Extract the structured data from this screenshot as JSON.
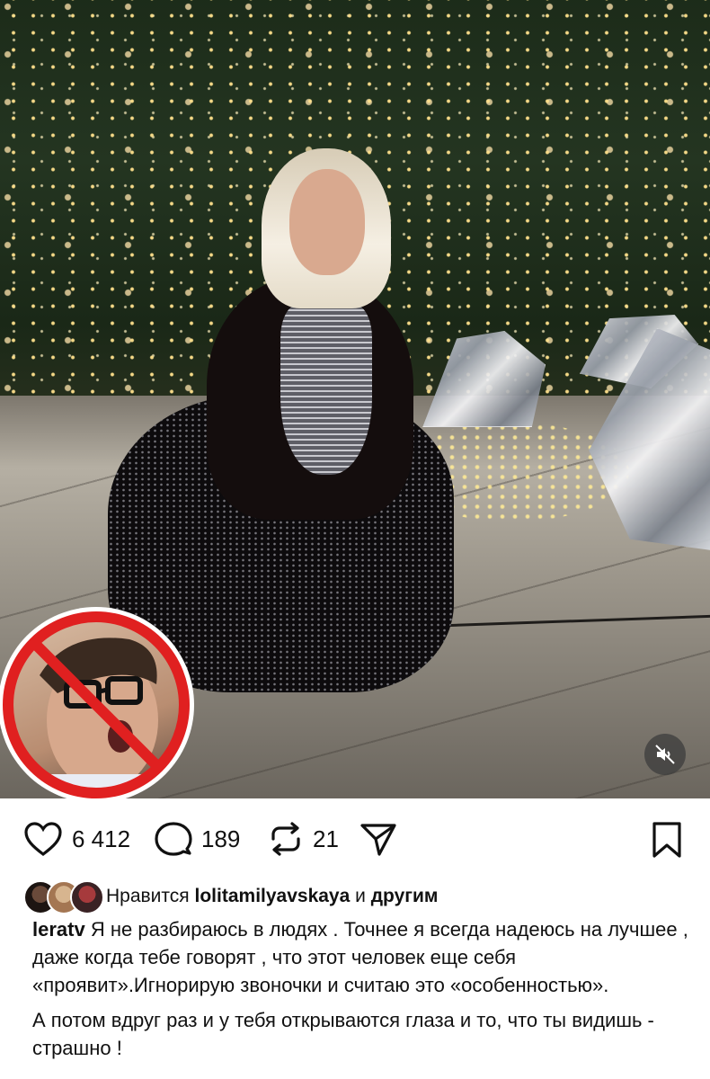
{
  "post": {
    "media": {
      "description_icons": [
        "christmas-tree",
        "mirror-umbrellas"
      ],
      "overlay_badge": {
        "icon": "no-sign-icon",
        "color": "#e02020"
      },
      "mute_button": {
        "icon": "speaker-muted-icon"
      }
    },
    "actions": {
      "likes_count": "6 412",
      "comments_count": "189",
      "reposts_count": "21"
    },
    "liked_by": {
      "prefix": "Нравится",
      "username": "lolitamilyavskaya",
      "conjunction": "и",
      "suffix": "другим"
    },
    "caption": {
      "author": "leratv",
      "paragraph1": "Я не разбираюсь в людях . Точнее я всегда надеюсь на лучшее , даже когда тебе говорят , что этот человек еще себя «проявит».Игнорирую звоночки и считаю это «особенностью».",
      "paragraph2": "А потом вдруг раз и у тебя открываются глаза и то, что ты видишь - страшно !"
    }
  }
}
